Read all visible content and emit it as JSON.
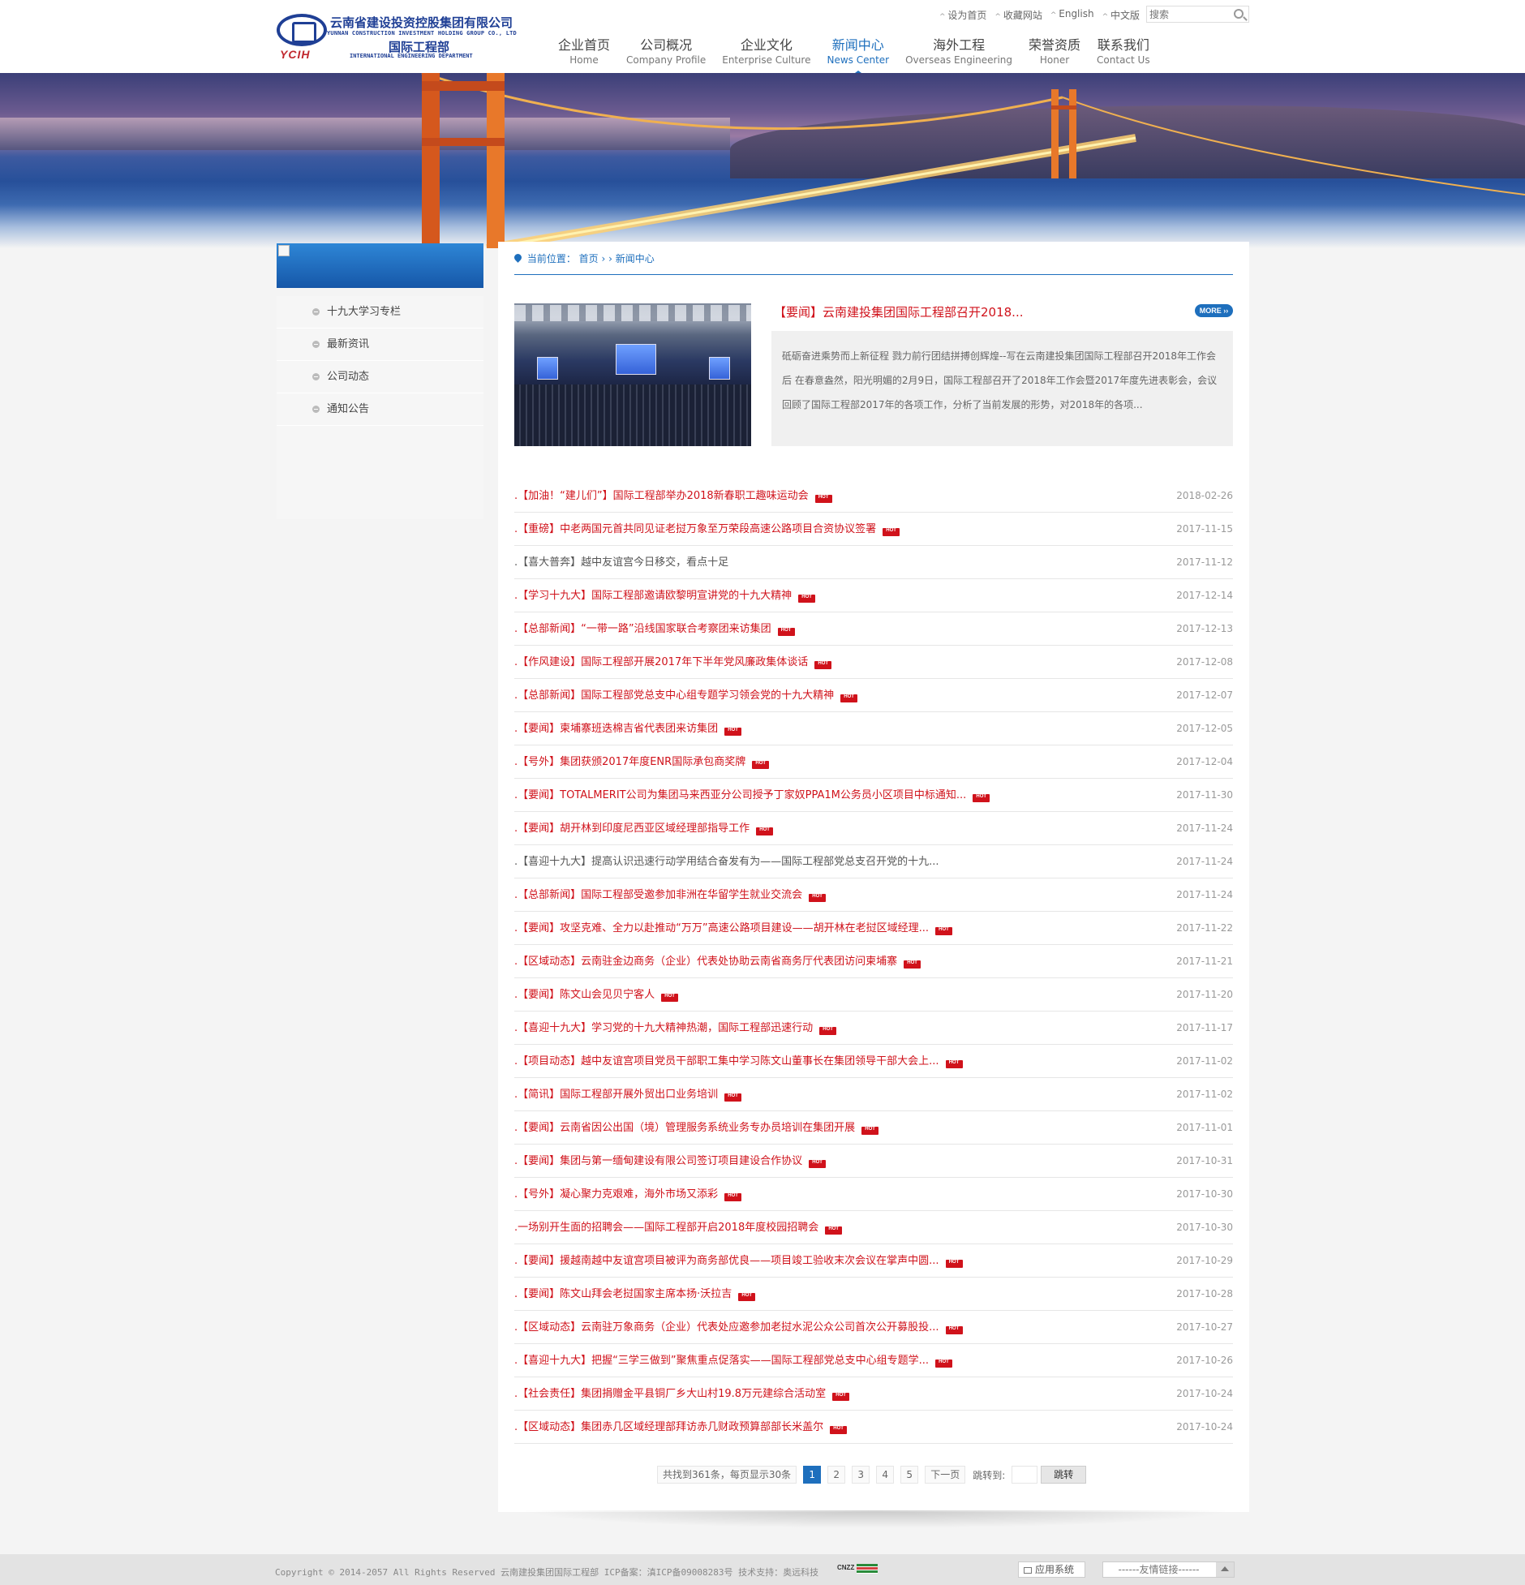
{
  "logo": {
    "company_cn": "云南省建设投资控股集团有限公司",
    "company_en": "YUNNAN CONSTRUCTION INVESTMENT HOLDING GROUP CO., LTD",
    "dept_cn": "国际工程部",
    "dept_en": "INTERNATIONAL ENGINEERING DEPARTMENT",
    "mark": "YCIH"
  },
  "toplinks": [
    "设为首页",
    "收藏网站",
    "English",
    "中文版"
  ],
  "search": {
    "placeholder": "搜索"
  },
  "nav": [
    {
      "cn": "企业首页",
      "en": "Home"
    },
    {
      "cn": "公司概况",
      "en": "Company Profile"
    },
    {
      "cn": "企业文化",
      "en": "Enterprise Culture"
    },
    {
      "cn": "新闻中心",
      "en": "News Center",
      "active": true
    },
    {
      "cn": "海外工程",
      "en": "Overseas Engineering"
    },
    {
      "cn": "荣誉资质",
      "en": "Honer"
    },
    {
      "cn": "联系我们",
      "en": "Contact Us"
    }
  ],
  "sidebar": {
    "items": [
      "十九大学习专栏",
      "最新资讯",
      "公司动态",
      "通知公告"
    ]
  },
  "breadcrumb": {
    "label": "当前位置：",
    "home": "首页",
    "current": "新闻中心"
  },
  "featured": {
    "title": "【要闻】云南建投集团国际工程部召开2018...",
    "more": "MORE ››",
    "summary": "砥砺奋进乘势而上新征程 戮力前行团结拼搏创辉煌--写在云南建投集团国际工程部召开2018年工作会后 在春意盎然，阳光明媚的2月9日，国际工程部召开了2018年工作会暨2017年度先进表彰会，会议回顾了国际工程部2017年的各项工作，分析了当前发展的形势，对2018年的各项..."
  },
  "news": [
    {
      "title": ".【加油！“建儿们”】国际工程部举办2018新春职工趣味运动会",
      "date": "2018-02-26",
      "hot": true
    },
    {
      "title": ".【重磅】中老两国元首共同见证老挝万象至万荣段高速公路项目合资协议签署",
      "date": "2017-11-15",
      "hot": true
    },
    {
      "title": ".【喜大普奔】越中友谊宫今日移交，看点十足",
      "date": "2017-11-12",
      "hot": false
    },
    {
      "title": ".【学习十九大】国际工程部邀请欧黎明宣讲党的十九大精神",
      "date": "2017-12-14",
      "hot": true
    },
    {
      "title": ".【总部新闻】“一带一路”沿线国家联合考察团来访集团",
      "date": "2017-12-13",
      "hot": true
    },
    {
      "title": ".【作风建设】国际工程部开展2017年下半年党风廉政集体谈话",
      "date": "2017-12-08",
      "hot": true
    },
    {
      "title": ".【总部新闻】国际工程部党总支中心组专题学习领会党的十九大精神",
      "date": "2017-12-07",
      "hot": true
    },
    {
      "title": ".【要闻】柬埔寨班迭棉吉省代表团来访集团",
      "date": "2017-12-05",
      "hot": true
    },
    {
      "title": ".【号外】集团获颁2017年度ENR国际承包商奖牌",
      "date": "2017-12-04",
      "hot": true
    },
    {
      "title": ".【要闻】TOTALMERIT公司为集团马来西亚分公司授予丁家奴PPA1M公务员小区项目中标通知...",
      "date": "2017-11-30",
      "hot": true
    },
    {
      "title": ".【要闻】胡开林到印度尼西亚区域经理部指导工作",
      "date": "2017-11-24",
      "hot": true
    },
    {
      "title": ".【喜迎十九大】提高认识迅速行动学用结合奋发有为——国际工程部党总支召开党的十九...",
      "date": "2017-11-24",
      "hot": false
    },
    {
      "title": ".【总部新闻】国际工程部受邀参加非洲在华留学生就业交流会",
      "date": "2017-11-24",
      "hot": true
    },
    {
      "title": ".【要闻】攻坚克难、全力以赴推动“万万”高速公路项目建设——胡开林在老挝区域经理...",
      "date": "2017-11-22",
      "hot": true
    },
    {
      "title": ".【区域动态】云南驻金边商务（企业）代表处协助云南省商务厅代表团访问柬埔寨",
      "date": "2017-11-21",
      "hot": true
    },
    {
      "title": ".【要闻】陈文山会见贝宁客人",
      "date": "2017-11-20",
      "hot": true
    },
    {
      "title": ".【喜迎十九大】学习党的十九大精神热潮，国际工程部迅速行动",
      "date": "2017-11-17",
      "hot": true
    },
    {
      "title": ".【项目动态】越中友谊宫项目党员干部职工集中学习陈文山董事长在集团领导干部大会上...",
      "date": "2017-11-02",
      "hot": true
    },
    {
      "title": ".【简讯】国际工程部开展外贸出口业务培训",
      "date": "2017-11-02",
      "hot": true
    },
    {
      "title": ".【要闻】云南省因公出国（境）管理服务系统业务专办员培训在集团开展",
      "date": "2017-11-01",
      "hot": true
    },
    {
      "title": ".【要闻】集团与第一缅甸建设有限公司签订项目建设合作协议",
      "date": "2017-10-31",
      "hot": true
    },
    {
      "title": ".【号外】凝心聚力克艰难，海外市场又添彩",
      "date": "2017-10-30",
      "hot": true
    },
    {
      "title": ".一场别开生面的招聘会——国际工程部开启2018年度校园招聘会",
      "date": "2017-10-30",
      "hot": true
    },
    {
      "title": ".【要闻】援越南越中友谊宫项目被评为商务部优良——项目竣工验收末次会议在掌声中圆...",
      "date": "2017-10-29",
      "hot": true
    },
    {
      "title": ".【要闻】陈文山拜会老挝国家主席本扬·沃拉吉",
      "date": "2017-10-28",
      "hot": true
    },
    {
      "title": ".【区域动态】云南驻万象商务（企业）代表处应邀参加老挝水泥公众公司首次公开募股投...",
      "date": "2017-10-27",
      "hot": true
    },
    {
      "title": ".【喜迎十九大】把握“三学三做到”聚焦重点促落实——国际工程部党总支中心组专题学...",
      "date": "2017-10-26",
      "hot": true
    },
    {
      "title": ".【社会责任】集团捐赠金平县铜厂乡大山村19.8万元建综合活动室",
      "date": "2017-10-24",
      "hot": true
    },
    {
      "title": ".【区域动态】集团赤几区域经理部拜访赤几财政预算部部长米盖尔",
      "date": "2017-10-24",
      "hot": true
    }
  ],
  "hot_label": "HOT",
  "pagination": {
    "info": "共找到361条，每页显示30条",
    "pages": [
      "1",
      "2",
      "3",
      "4",
      "5"
    ],
    "current": "1",
    "next": "下一页",
    "jump_label": "跳转到:",
    "go": "跳转"
  },
  "footer": {
    "copyright": "Copyright © 2014-2057  All Rights Reserved 云南建投集团国际工程部 ICP备案：滇ICP备09008283号  技术支持：奥远科技",
    "cnzz": "CNZZ",
    "app_system": "应用系统",
    "friend_links": "------友情链接------"
  },
  "colors": {
    "accent": "#1e6fbd",
    "news_red": "#d0121b"
  }
}
